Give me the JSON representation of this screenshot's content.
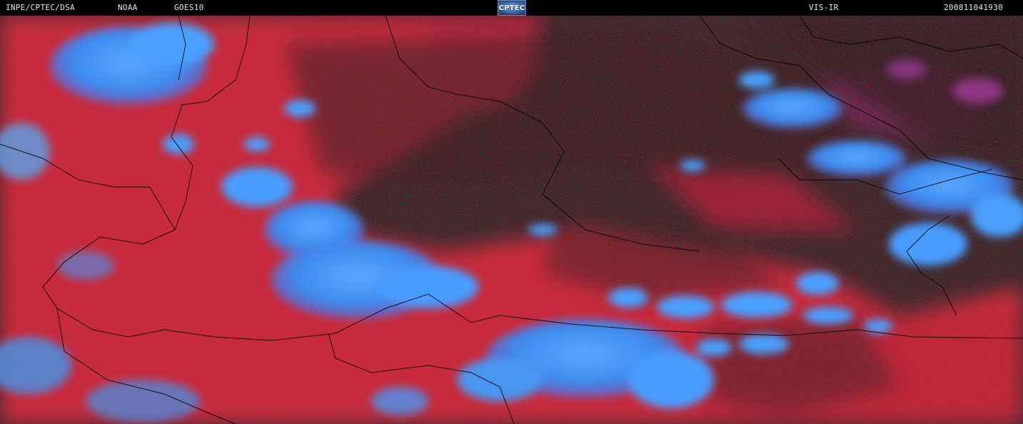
{
  "header": {
    "source_label": "INPE/CPTEC/DSA",
    "agency_label": "NOAA",
    "satellite_label": "GOES10",
    "logo_text": "CPTEC",
    "channel_label": "VIS-IR",
    "timestamp_label": "200811041930"
  },
  "colors": {
    "header_background": "#000000",
    "header_text": "#e8e8e8",
    "land_red": "#c8283a",
    "cloud_blue": "#3c8ef2",
    "dark_background": "#262626",
    "border_lines": "#000000"
  },
  "image": {
    "type": "satellite-composite",
    "description_icon": "satellite-vis-ir-icon"
  }
}
